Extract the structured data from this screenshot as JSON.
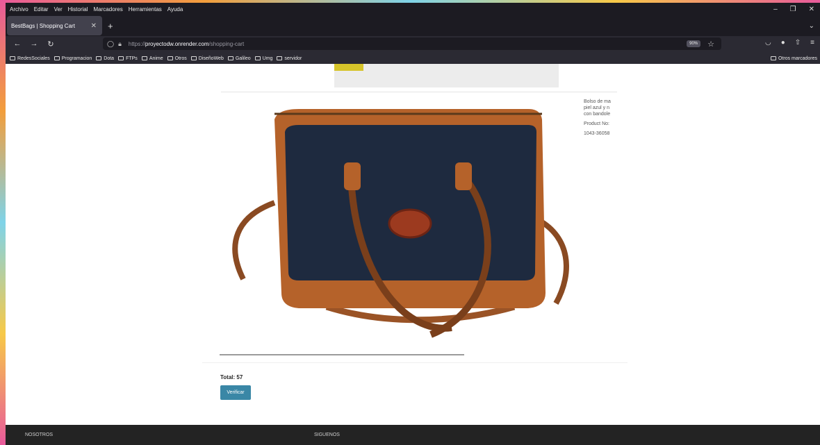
{
  "menu": {
    "items": [
      "Archivo",
      "Editar",
      "Ver",
      "Historial",
      "Marcadores",
      "Herramientas",
      "Ayuda"
    ]
  },
  "tab": {
    "title": "BestBags | Shopping Cart"
  },
  "address": {
    "url_prefix": "https://",
    "url_host": "proyectodw.onrender.com",
    "url_path": "/shopping-cart",
    "zoom": "90%"
  },
  "bookmarks": {
    "items": [
      "RedesSociales",
      "Programacion",
      "Dota",
      "FTPs",
      "Anime",
      "Otros",
      "DiseñoWeb",
      "Galileo",
      "Umg",
      "servidor"
    ],
    "other": "Otros marcadores"
  },
  "product": {
    "description": "Bolso de ma piel azul y n con bandole",
    "product_no_label": "Product No:",
    "product_no": "1043-36058"
  },
  "cart": {
    "total": "Total: 57",
    "verify_label": "Verificar"
  },
  "footer": {
    "col1": "NOSOTROS",
    "col2": "SIGUENOS"
  },
  "colors": {
    "browser_dark": "#1c1b22",
    "toolbar": "#2b2a33",
    "button": "#3a87a6",
    "bag_navy": "#1e2a3f",
    "bag_tan": "#b5622a"
  }
}
